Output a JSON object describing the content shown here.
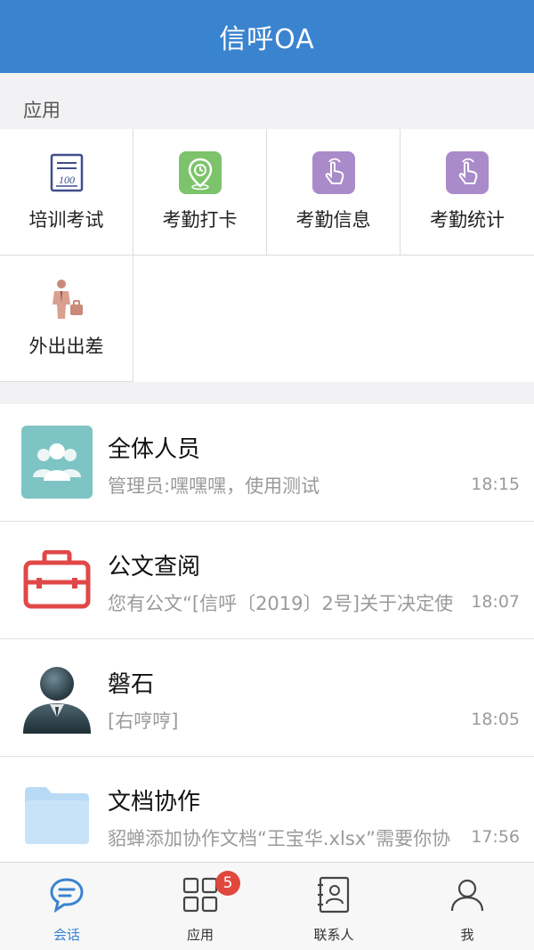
{
  "header": {
    "title": "信呼OA"
  },
  "apps_section": {
    "label": "应用",
    "items": [
      {
        "label": "培训考试",
        "icon": "exam-paper-icon"
      },
      {
        "label": "考勤打卡",
        "icon": "clock-in-location-icon"
      },
      {
        "label": "考勤信息",
        "icon": "tap-hand-icon"
      },
      {
        "label": "考勤统计",
        "icon": "tap-hand-icon"
      },
      {
        "label": "外出出差",
        "icon": "business-trip-icon"
      }
    ]
  },
  "conversations": [
    {
      "name": "全体人员",
      "preview": "管理员:嘿嘿嘿，使用测试",
      "time": "18:15",
      "avatar": "group-icon"
    },
    {
      "name": "公文查阅",
      "preview": "您有公文“[信呼〔2019〕2号]关于决定使",
      "time": "18:07",
      "avatar": "briefcase-icon"
    },
    {
      "name": "磐石",
      "preview": "[右哼哼]",
      "time": "18:05",
      "avatar": "person-avatar-icon"
    },
    {
      "name": "文档协作",
      "preview": "貂蝉添加协作文档“王宝华.xlsx”需要你协",
      "time": "17:56",
      "avatar": "folder-icon"
    }
  ],
  "tabbar": {
    "items": [
      {
        "label": "会话",
        "icon": "chat-bubble-icon",
        "active": true
      },
      {
        "label": "应用",
        "icon": "apps-grid-icon",
        "active": false
      },
      {
        "label": "联系人",
        "icon": "contacts-book-icon",
        "active": false
      },
      {
        "label": "我",
        "icon": "user-profile-icon",
        "active": false
      }
    ],
    "apps_badge": "5"
  },
  "colors": {
    "primary": "#3a83cf",
    "badge": "#e0483e",
    "app_purple": "#a98bc9",
    "app_green": "#7cc36b",
    "group_teal": "#7ec4c4",
    "briefcase_red": "#e04848",
    "folder_blue": "#b9daf5"
  }
}
